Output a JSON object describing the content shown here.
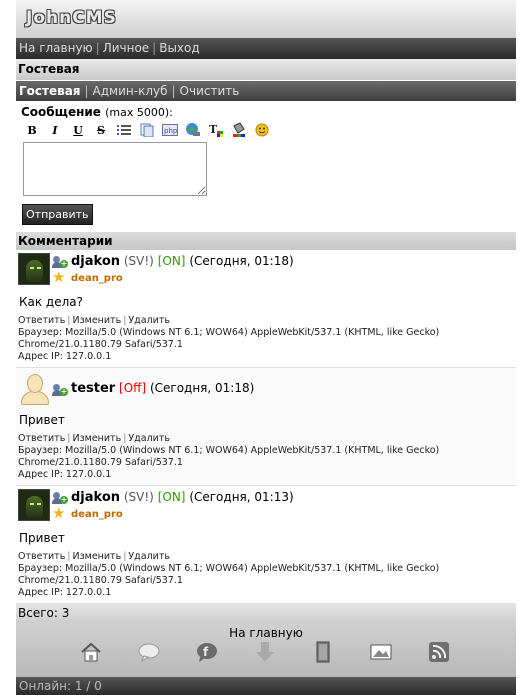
{
  "logo": "JohnCMS",
  "nav": [
    "На главную",
    "Личное",
    "Выход"
  ],
  "page_title": "Гостевая",
  "subnav": {
    "current": "Гостевая",
    "items": [
      "Админ-клуб",
      "Очистить"
    ]
  },
  "form": {
    "label": "Сообщение",
    "limit": "(max 5000):",
    "textarea_value": "",
    "submit": "Отправить",
    "toolbar": [
      "bold-icon",
      "italic-icon",
      "underline-icon",
      "strike-icon",
      "list-icon",
      "quote-icon",
      "php-icon",
      "link-icon",
      "color-icon",
      "background-icon",
      "smiley-icon"
    ],
    "toolbar_labels": {
      "bold": "B",
      "italic": "I",
      "underline": "U",
      "strike": "S"
    }
  },
  "comments_title": "Комментарии",
  "posts": [
    {
      "nick": "djakon",
      "rights": "(SV!)",
      "state": "[ON]",
      "time": "(Сегодня, 01:18)",
      "status": "dean_pro",
      "text": "Как дела?",
      "actions": [
        "Ответить",
        "Изменить",
        "Удалить"
      ],
      "browser": "Браузер: Mozilla/5.0 (Windows NT 6.1; WOW64) AppleWebKit/537.1 (KHTML, like Gecko) Chrome/21.0.1180.79 Safari/537.1",
      "ip": "Адрес IP: 127.0.0.1"
    },
    {
      "nick": "tester",
      "rights": "",
      "state": "[Off]",
      "time": "(Сегодня, 01:18)",
      "status": "",
      "text": "Привет",
      "actions": [
        "Ответить",
        "Изменить",
        "Удалить"
      ],
      "browser": "Браузер: Mozilla/5.0 (Windows NT 6.1; WOW64) AppleWebKit/537.1 (KHTML, like Gecko) Chrome/21.0.1180.79 Safari/537.1",
      "ip": "Адрес IP: 127.0.0.1"
    },
    {
      "nick": "djakon",
      "rights": "(SV!)",
      "state": "[ON]",
      "time": "(Сегодня, 01:13)",
      "status": "dean_pro",
      "text": "Привет",
      "actions": [
        "Ответить",
        "Изменить",
        "Удалить"
      ],
      "browser": "Браузер: Mozilla/5.0 (Windows NT 6.1; WOW64) AppleWebKit/537.1 (KHTML, like Gecko) Chrome/21.0.1180.79 Safari/537.1",
      "ip": "Адрес IP: 127.0.0.1"
    }
  ],
  "total": "Всего: 3",
  "footer": {
    "home": "На главную",
    "icons": [
      "home-icon",
      "chat-icon",
      "forum-icon",
      "download-icon",
      "library-icon",
      "gallery-icon",
      "rss-icon"
    ]
  },
  "online": "Онлайн: 1 / 0"
}
